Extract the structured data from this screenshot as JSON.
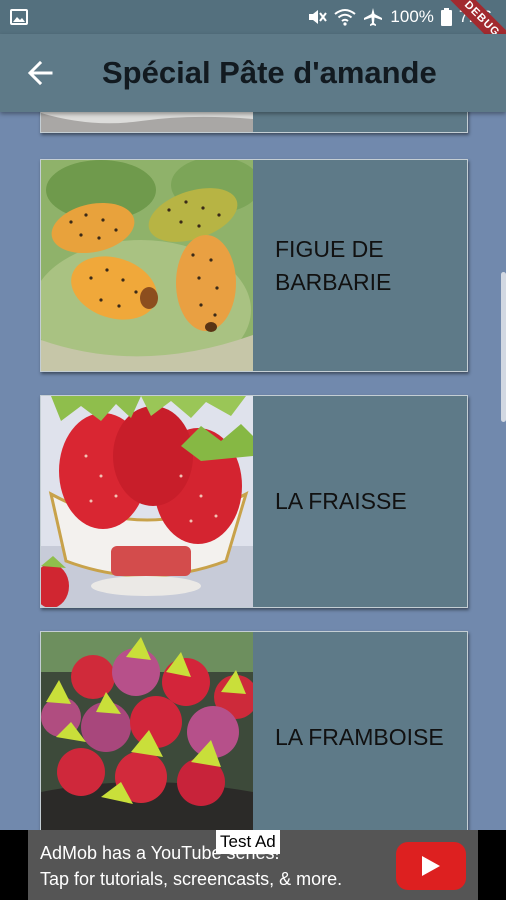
{
  "status_bar": {
    "battery_percent": "100%",
    "time": "7:46",
    "debug_label": "DEBUG"
  },
  "app_bar": {
    "title": "Spécial Pâte d'amande",
    "back_icon": "arrow-back-icon"
  },
  "items": [
    {
      "label": "",
      "image": "partial-top-image"
    },
    {
      "label": "FIGUE DE BARBARIE",
      "image": "prickly-pear-marzipan"
    },
    {
      "label": "LA FRAISSE",
      "image": "strawberry-marzipan"
    },
    {
      "label": "LA FRAMBOISE",
      "image": "raspberry-marzipan"
    }
  ],
  "ad": {
    "badge": "Test Ad",
    "line1": "AdMob has a YouTube series!",
    "line2": "Tap for tutorials, screencasts, & more.",
    "icon": "youtube-play-icon"
  },
  "colors": {
    "background": "#7189ad",
    "app_bar": "#5e7a88",
    "card": "#5e7a88",
    "debug_ribbon": "#a22a2f"
  }
}
